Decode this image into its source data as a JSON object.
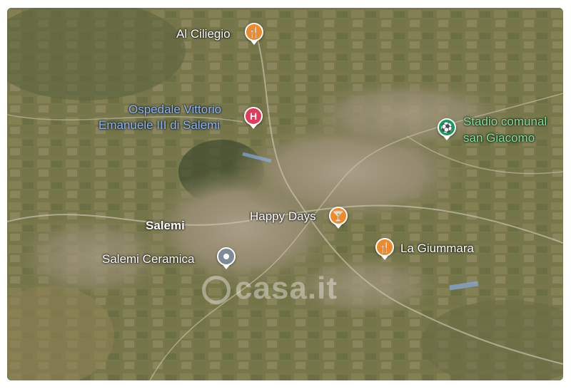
{
  "map": {
    "places": [
      {
        "name": "Al Ciliegio",
        "kind": "restaurant",
        "icon": "fork-knife-icon",
        "color": "#ef8a2a"
      },
      {
        "name_line1": "Ospedale Vittorio",
        "name_line2": "Emanuele III di Salemi",
        "kind": "hospital",
        "icon": "hospital-icon",
        "glyph": "H",
        "color": "#e33b57"
      },
      {
        "name_line1": "Stadio comunal",
        "name_line2": "san Giacomo",
        "kind": "stadium",
        "icon": "stadium-icon",
        "color": "#0f9d58"
      },
      {
        "name": "Happy Days",
        "kind": "bar",
        "icon": "cocktail-icon",
        "color": "#ef8a2a"
      },
      {
        "name": "La Giummara",
        "kind": "restaurant",
        "icon": "fork-knife-icon",
        "color": "#ef8a2a"
      },
      {
        "name": "Salemi Ceramica",
        "kind": "shop",
        "icon": "location-pin-icon",
        "color": "#7d8b96"
      }
    ],
    "town_label": "Salemi",
    "watermark": "casa.it"
  }
}
